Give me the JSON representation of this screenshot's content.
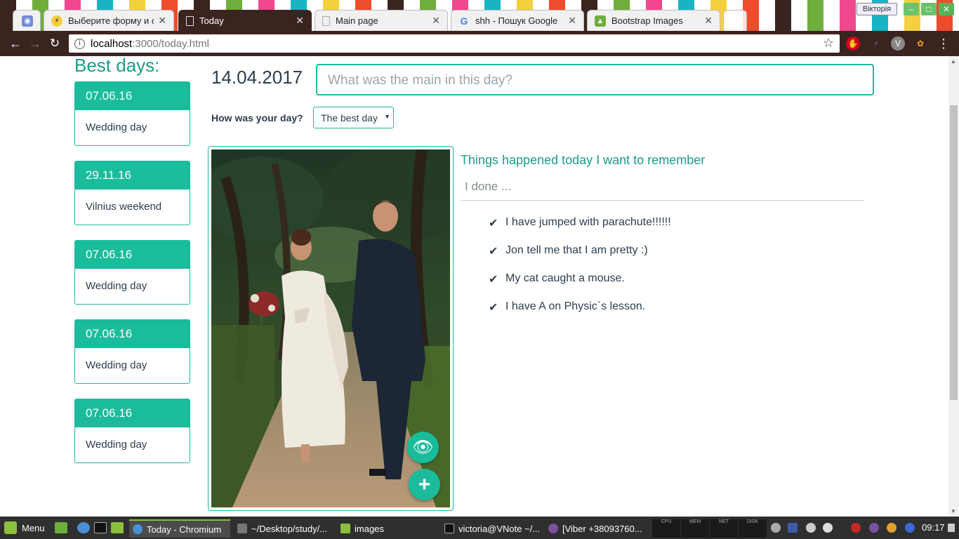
{
  "window": {
    "user_badge": "Вікторія",
    "minimize": "‒",
    "maximize": "□",
    "close": "✕"
  },
  "tabs": [
    {
      "label": "",
      "favicon": "discord-icon",
      "color": "#7289da"
    },
    {
      "label": "Выберите форму и об",
      "favicon": "lightning-icon",
      "color": "#f4d03f"
    },
    {
      "label": "Today",
      "favicon": "document-icon",
      "color": "#ffffff",
      "active": true
    },
    {
      "label": "Main page",
      "favicon": "document-icon",
      "color": "#cccccc"
    },
    {
      "label": "shh - Пошук Google",
      "favicon": "google-icon",
      "color": "#4285f4"
    },
    {
      "label": "Bootstrap Images",
      "favicon": "image-icon",
      "color": "#6fae3c"
    }
  ],
  "address": {
    "host": "localhost",
    "path": ":3000/today.html"
  },
  "sidebar": {
    "title": "Best days:",
    "days": [
      {
        "date": "07.06.16",
        "name": "Wedding day"
      },
      {
        "date": "29.11.16",
        "name": "Vilnius weekend"
      },
      {
        "date": "07.06.16",
        "name": "Wedding day"
      },
      {
        "date": "07.06.16",
        "name": "Wedding day"
      },
      {
        "date": "07.06.16",
        "name": "Wedding day"
      }
    ]
  },
  "main": {
    "date": "14.04.2017",
    "main_placeholder": "What was the main in this day?",
    "how_label": "How was your day?",
    "day_rating": "The best day",
    "things_title": "Things happened today I want to remember",
    "done_placeholder": "I done ...",
    "things": [
      "I have jumped with parachute!!!!!!",
      "Jon tell me that I am pretty :)",
      "My cat caught a mouse.",
      "I have A on Physic`s lesson."
    ],
    "check_mark": "✔",
    "view_button": "👁",
    "add_button": "+"
  },
  "taskbar": {
    "menu_label": "Menu",
    "items": [
      {
        "label": "Today - Chromium",
        "active": true
      },
      {
        "label": "~/Desktop/study/..."
      },
      {
        "label": "images"
      },
      {
        "label": "victoria@VNote ~/..."
      },
      {
        "label": "[Viber +38093760..."
      }
    ],
    "monitors": [
      "CPU",
      "MEM",
      "NET",
      "DISK"
    ],
    "clock": "09:17"
  },
  "colors": {
    "accent": "#1abc9c",
    "accent_dark": "#1a9e86",
    "text": "#2c3e50",
    "chrome": "#3a2420"
  }
}
